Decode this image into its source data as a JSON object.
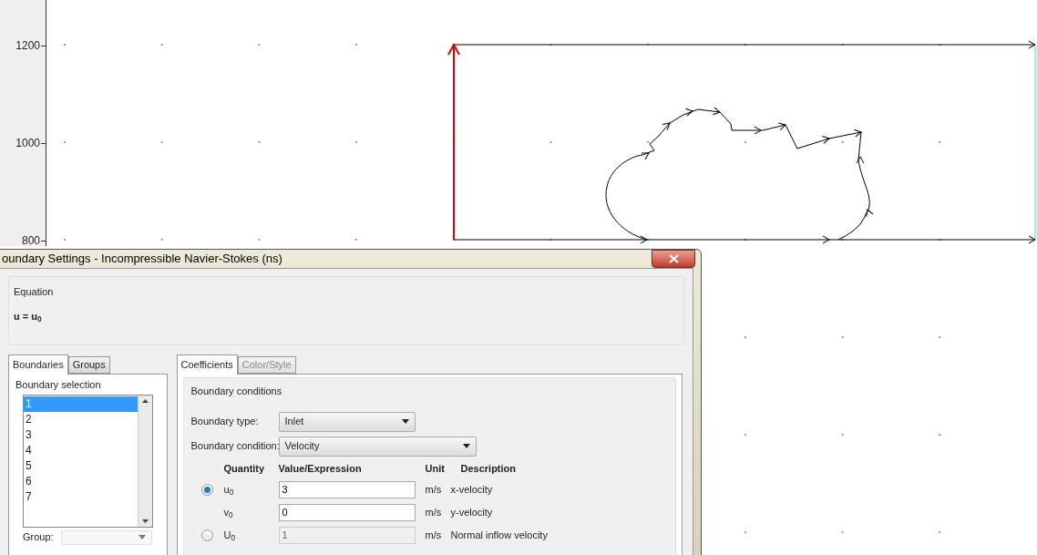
{
  "canvas": {
    "y_axis_ticks": [
      "1200",
      "1000",
      "800"
    ]
  },
  "dialog": {
    "title": "oundary Settings - Incompressible Navier-Stokes (ns)",
    "equation": {
      "label": "Equation",
      "formula": "u = u$_{0}$"
    },
    "left_tabs": [
      {
        "label": "Boundaries",
        "selected": true
      },
      {
        "label": "Groups",
        "selected": false
      }
    ],
    "boundary_selection": {
      "label": "Boundary selection",
      "items": [
        {
          "label": "1",
          "selected": true
        },
        {
          "label": "2",
          "selected": false
        },
        {
          "label": "3",
          "selected": false
        },
        {
          "label": "4",
          "selected": false
        },
        {
          "label": "5",
          "selected": false
        },
        {
          "label": "6",
          "selected": false
        },
        {
          "label": "7",
          "selected": false
        }
      ]
    },
    "group": {
      "label": "Group:",
      "disabled": true
    },
    "right_tabs": [
      {
        "label": "Coefficients",
        "selected": true,
        "disabled": false
      },
      {
        "label": "Color/Style",
        "selected": false,
        "disabled": true
      }
    ],
    "boundary_conditions": {
      "label": "Boundary conditions",
      "boundary_type": {
        "label": "Boundary type:",
        "value": "Inlet"
      },
      "boundary_condition": {
        "label": "Boundary condition:",
        "value": "Velocity"
      },
      "columns": [
        "Quantity",
        "Value/Expression",
        "Unit",
        "Description"
      ],
      "rows": [
        {
          "kind": "radio",
          "selected": true,
          "quantity": "u$_{0}$",
          "value": "3",
          "disabled": false,
          "unit": "m/s",
          "description": "x-velocity"
        },
        {
          "kind": "plain",
          "quantity": "v$_{0}$",
          "value": "0",
          "disabled": false,
          "unit": "m/s",
          "description": "y-velocity"
        },
        {
          "kind": "radio",
          "selected": false,
          "quantity": "U$_{0}$",
          "value": "1",
          "disabled": true,
          "unit": "m/s",
          "description": "Normal inflow velocity"
        }
      ]
    }
  }
}
